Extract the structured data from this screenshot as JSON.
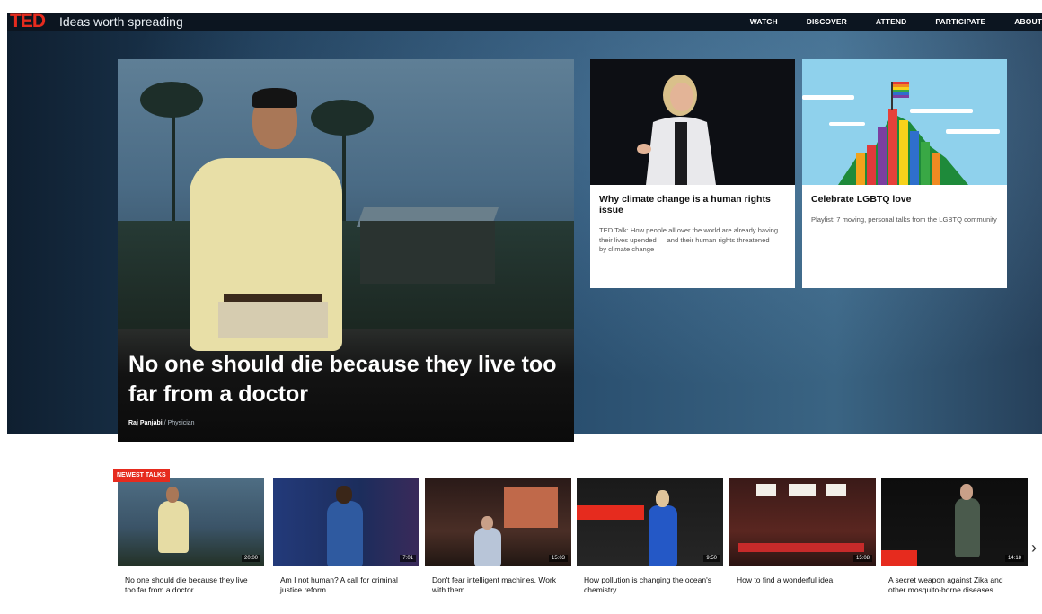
{
  "brand": {
    "logo": "TED",
    "tagline": "Ideas worth spreading",
    "accent": "#e62b1e"
  },
  "nav": [
    "WATCH",
    "DISCOVER",
    "ATTEND",
    "PARTICIPATE",
    "ABOUT"
  ],
  "feature": {
    "title": "No one should die because they live too far from a doctor",
    "speaker": "Raj Panjabi",
    "role": "Physician"
  },
  "cards": [
    {
      "title": "Why climate change is a human rights issue",
      "description": "TED Talk: How people all over the world are already having their lives upended — and their human rights threatened — by climate change"
    },
    {
      "title": "Celebrate LGBTQ love",
      "description": "Playlist: 7 moving, personal talks from the LGBTQ community"
    }
  ],
  "newest": {
    "label": "NEWEST TALKS",
    "talks": [
      {
        "title": "No one should die because they live too far from a doctor",
        "duration": "20:00"
      },
      {
        "title": "Am I not human? A call for criminal justice reform",
        "duration": "7:01"
      },
      {
        "title": "Don't fear intelligent machines. Work with them",
        "duration": "15:03"
      },
      {
        "title": "How pollution is changing the ocean's chemistry",
        "duration": "9:50"
      },
      {
        "title": "How to find a wonderful idea",
        "duration": "15:08"
      },
      {
        "title": "A secret weapon against Zika and other mosquito-borne diseases",
        "duration": "14:18"
      }
    ]
  },
  "icons": {
    "next": "chevron-right-icon"
  }
}
